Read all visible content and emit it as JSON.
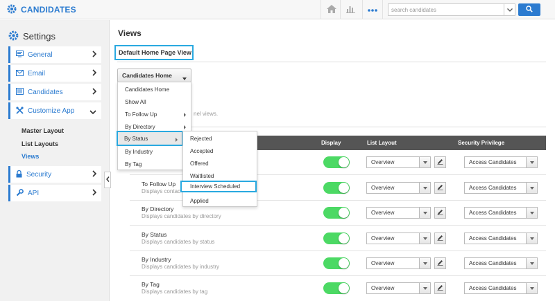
{
  "header": {
    "app_title": "CANDIDATES",
    "search_placeholder": "search candidates",
    "accent_color": "#2b7bd0",
    "icons": [
      "settings-gear-logo-icon",
      "home-icon",
      "bar-chart-icon",
      "more-dots-icon",
      "chevron-down-icon",
      "search-icon"
    ]
  },
  "sidebar": {
    "title": "Settings",
    "items": [
      {
        "label": "General",
        "icon": "monitor-icon"
      },
      {
        "label": "Email",
        "icon": "envelope-icon"
      },
      {
        "label": "Candidates",
        "icon": "list-icon"
      },
      {
        "label": "Customize App",
        "icon": "tools-icon",
        "expanded": true
      },
      {
        "label": "Security",
        "icon": "lock-icon"
      },
      {
        "label": "API",
        "icon": "wrench-icon"
      }
    ],
    "sub_items": [
      {
        "label": "Master Layout"
      },
      {
        "label": "List Layouts"
      },
      {
        "label": "Views",
        "active": true
      }
    ]
  },
  "main": {
    "page_title": "Views",
    "section_title": "Default Home Page View",
    "selected_view": "Candidates Home",
    "partial_text": "nel views.",
    "dropdown": {
      "items": [
        {
          "label": "Candidates Home"
        },
        {
          "label": "Show All"
        },
        {
          "label": "To Follow Up",
          "has_submenu": true
        },
        {
          "label": "By Directory",
          "has_submenu": true
        },
        {
          "label": "By Status",
          "has_submenu": true,
          "highlighted": true
        },
        {
          "label": "By Industry",
          "has_submenu": true
        },
        {
          "label": "By Tag"
        }
      ],
      "status_submenu": [
        {
          "label": "Rejected"
        },
        {
          "label": "Accepted"
        },
        {
          "label": "Offered"
        },
        {
          "label": "Waitlisted"
        },
        {
          "label": "Interview Scheduled",
          "highlighted": true
        },
        {
          "label": "Applied"
        }
      ]
    },
    "table": {
      "headers": {
        "display": "Display",
        "list_layout": "List Layout",
        "security_privilege": "Security Privilege"
      },
      "rows": [
        {
          "name": "",
          "desc": "",
          "display_on": true,
          "layout": "Overview",
          "privilege": "Access Candidates"
        },
        {
          "name": "To Follow Up",
          "desc": "Displays contac",
          "display_on": true,
          "layout": "Overview",
          "privilege": "Access Candidates"
        },
        {
          "name": "By Directory",
          "desc": "Displays candidates by directory",
          "display_on": true,
          "layout": "Overview",
          "privilege": "Access Candidates"
        },
        {
          "name": "By Status",
          "desc": "Displays candidates by status",
          "display_on": true,
          "layout": "Overview",
          "privilege": "Access Candidates"
        },
        {
          "name": "By Industry",
          "desc": "Displays candidates by industry",
          "display_on": true,
          "layout": "Overview",
          "privilege": "Access Candidates"
        },
        {
          "name": "By Tag",
          "desc": "Displays candidates by tag",
          "display_on": true,
          "layout": "Overview",
          "privilege": "Access Candidates"
        }
      ]
    }
  }
}
